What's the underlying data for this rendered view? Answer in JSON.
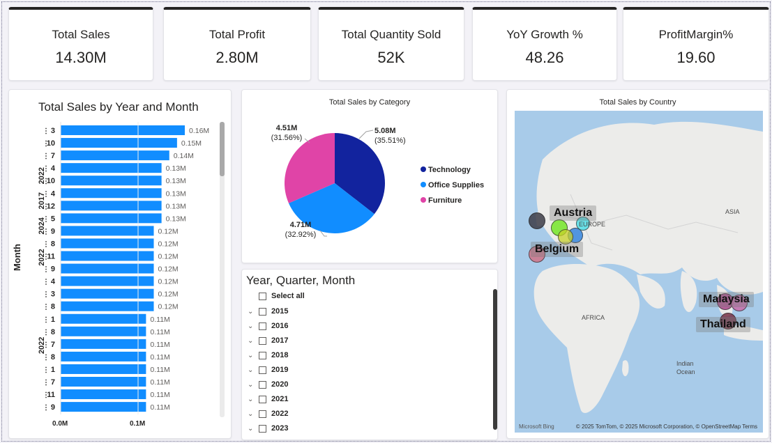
{
  "kpis": [
    {
      "title": "Total Sales",
      "value": "14.30M"
    },
    {
      "title": "Total Profit",
      "value": "2.80M"
    },
    {
      "title": "Total Quantity Sold",
      "value": "52K"
    },
    {
      "title": "YoY Growth %",
      "value": "48.26"
    },
    {
      "title": "ProfitMargin%",
      "value": "19.60"
    }
  ],
  "bar_panel": {
    "title": "Total Sales by Year and Month",
    "y_axis_label": "Month",
    "x_ticks": [
      "0.0M",
      "0.1M"
    ]
  },
  "pie_panel": {
    "title": "Total Sales by Category"
  },
  "slicer": {
    "title": "Year, Quarter, Month",
    "select_all": "Select all",
    "years": [
      "2015",
      "2016",
      "2017",
      "2018",
      "2019",
      "2020",
      "2021",
      "2022",
      "2023"
    ]
  },
  "map": {
    "title": "Total Sales by Country",
    "countries": [
      "Austria",
      "Belgium",
      "Malaysia",
      "Thailand"
    ],
    "regions": [
      "EUROPE",
      "ASIA",
      "AFRICA",
      "Indian",
      "Ocean"
    ],
    "provider": "Microsoft Bing",
    "credits": "© 2025 TomTom, © 2025 Microsoft Corporation, © OpenStreetMap   Terms"
  },
  "colors": {
    "bar": "#118dff",
    "technology": "#12239e",
    "office_supplies": "#118dff",
    "furniture": "#e044a7"
  },
  "chart_data": [
    {
      "type": "bar",
      "orientation": "horizontal",
      "title": "Total Sales by Year and Month",
      "ylabel": "Month",
      "xlabel": "",
      "xlim": [
        0,
        0.16
      ],
      "year_groups": [
        {
          "label": "",
          "rows": 3
        },
        {
          "label": "2022",
          "rows": 2
        },
        {
          "label": "2017",
          "rows": 2
        },
        {
          "label": "2024",
          "rows": 2
        },
        {
          "label": "2022",
          "rows": 3
        },
        {
          "label": "",
          "rows": 4
        },
        {
          "label": "2022",
          "rows": 3
        },
        {
          "label": "",
          "rows": 4
        }
      ],
      "categories": [
        "3",
        "10",
        "7",
        "4",
        "10",
        "4",
        "12",
        "5",
        "9",
        "8",
        "11",
        "9",
        "4",
        "3",
        "8",
        "1",
        "8",
        "7",
        "8",
        "1",
        "7",
        "11",
        "9"
      ],
      "values": [
        0.16,
        0.15,
        0.14,
        0.13,
        0.13,
        0.13,
        0.13,
        0.13,
        0.12,
        0.12,
        0.12,
        0.12,
        0.12,
        0.12,
        0.12,
        0.11,
        0.11,
        0.11,
        0.11,
        0.11,
        0.11,
        0.11,
        0.11
      ],
      "data_labels": [
        "0.16M",
        "0.15M",
        "0.14M",
        "0.13M",
        "0.13M",
        "0.13M",
        "0.13M",
        "0.13M",
        "0.12M",
        "0.12M",
        "0.12M",
        "0.12M",
        "0.12M",
        "0.12M",
        "0.12M",
        "0.11M",
        "0.11M",
        "0.11M",
        "0.11M",
        "0.11M",
        "0.11M",
        "0.11M",
        "0.11M"
      ],
      "x_ticks": [
        "0.0M",
        "0.1M"
      ]
    },
    {
      "type": "pie",
      "title": "Total Sales by Category",
      "legend": "right",
      "slices": [
        {
          "name": "Technology",
          "value": 5.08,
          "label": "5.08M",
          "pct": "(35.51%)",
          "color": "#12239e"
        },
        {
          "name": "Office Supplies",
          "value": 4.71,
          "label": "4.71M",
          "pct": "(32.92%)",
          "color": "#118dff"
        },
        {
          "name": "Furniture",
          "value": 4.51,
          "label": "4.51M",
          "pct": "(31.56%)",
          "color": "#e044a7"
        }
      ]
    }
  ]
}
